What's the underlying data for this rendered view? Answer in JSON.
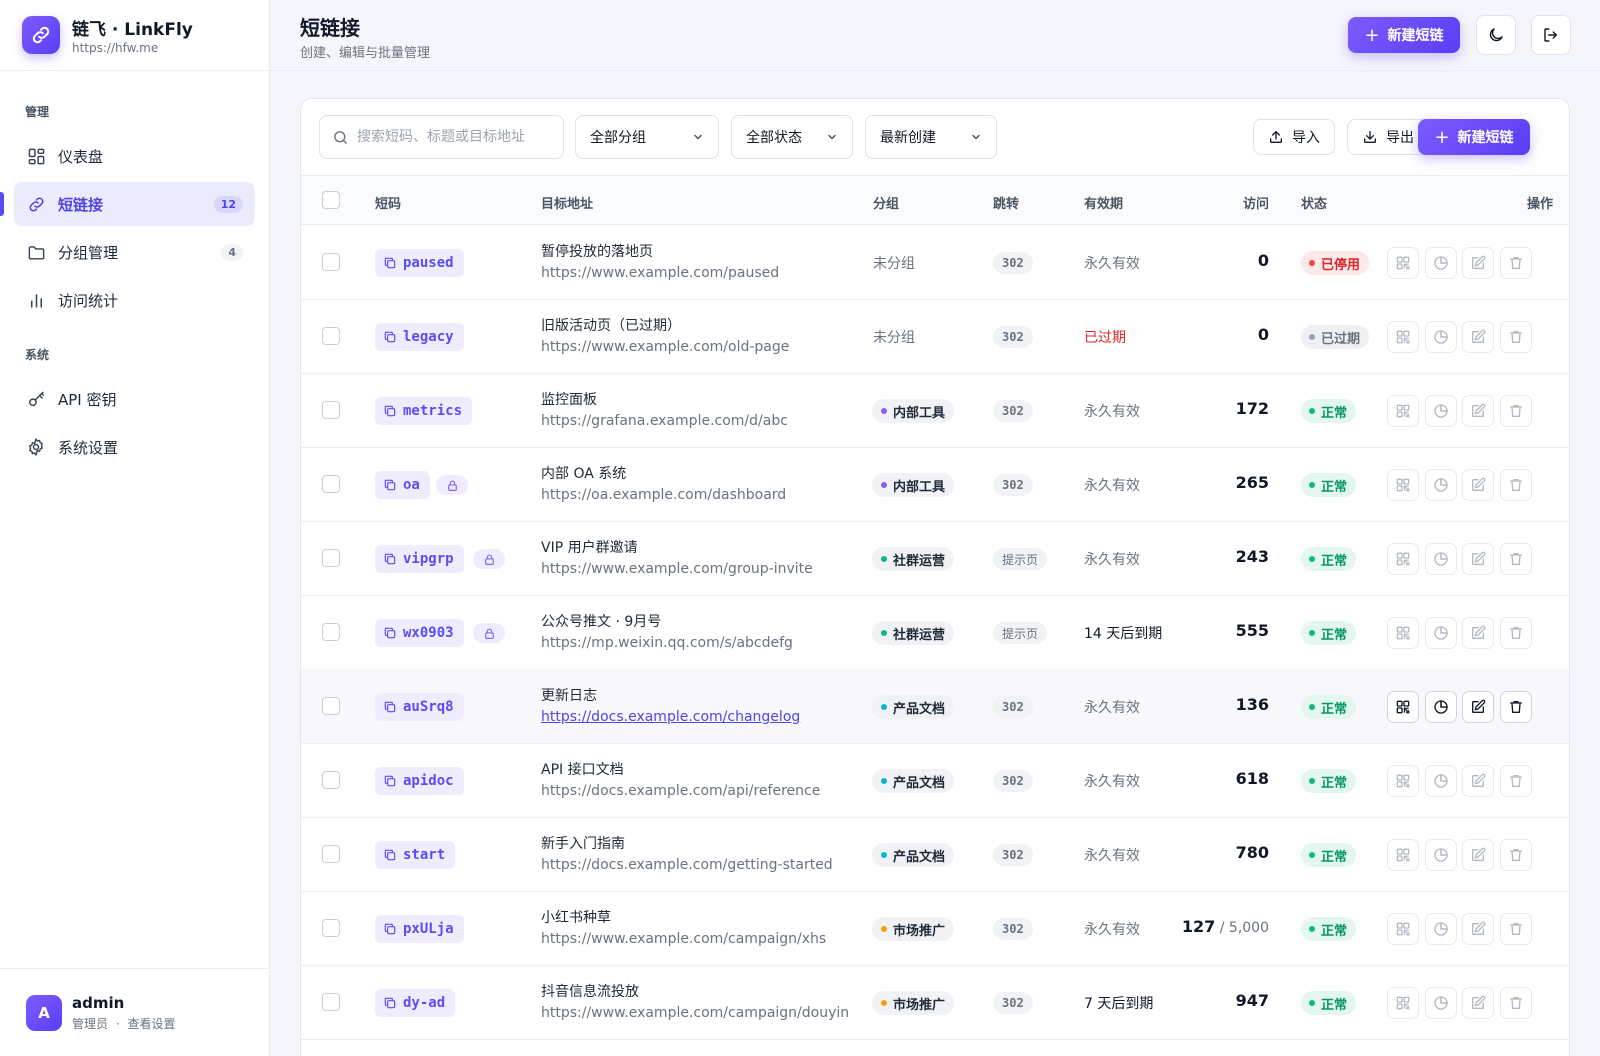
{
  "brand": {
    "title": "链飞 · LinkFly",
    "domain": "https://hfw.me"
  },
  "nav": {
    "section_manage": "管理",
    "section_system": "系统",
    "items": [
      {
        "label": "仪表盘",
        "icon": "dashboard-icon"
      },
      {
        "label": "短链接",
        "icon": "link-icon",
        "badge": "12",
        "active": true
      },
      {
        "label": "分组管理",
        "icon": "folder-icon",
        "badge": "4"
      },
      {
        "label": "访问统计",
        "icon": "bar-chart-icon"
      },
      {
        "label": "API 密钥",
        "icon": "key-icon"
      },
      {
        "label": "系统设置",
        "icon": "gear-icon"
      }
    ]
  },
  "user": {
    "initial": "A",
    "name": "admin",
    "role": "管理员",
    "settings_link": "查看设置",
    "separator": "·"
  },
  "header": {
    "title": "短链接",
    "subtitle": "创建、编辑与批量管理",
    "new_button": "新建短链"
  },
  "toolbar": {
    "search_placeholder": "搜索短码、标题或目标地址",
    "group_filter": "全部分组",
    "status_filter": "全部状态",
    "sort": "最新创建",
    "import": "导入",
    "export": "导出",
    "new_button": "新建短链"
  },
  "table": {
    "columns": {
      "code": "短码",
      "target": "目标地址",
      "group": "分组",
      "redirect": "跳转",
      "expiry": "有效期",
      "visits": "访问",
      "status": "状态",
      "actions": "操作"
    },
    "rows": [
      {
        "code": "paused",
        "locked": false,
        "title": "暂停投放的落地页",
        "url": "https://www.example.com/paused",
        "group": "未分组",
        "group_color": "",
        "redirect": "302",
        "expiry": "永久有效",
        "expiry_style": "normal",
        "visits": "0",
        "limit": "",
        "status": "已停用",
        "status_type": "stopped"
      },
      {
        "code": "legacy",
        "locked": false,
        "title": "旧版活动页（已过期）",
        "url": "https://www.example.com/old-page",
        "group": "未分组",
        "group_color": "",
        "redirect": "302",
        "expiry": "已过期",
        "expiry_style": "red",
        "visits": "0",
        "limit": "",
        "status": "已过期",
        "status_type": "expired"
      },
      {
        "code": "metrics",
        "locked": false,
        "title": "监控面板",
        "url": "https://grafana.example.com/d/abc",
        "group": "内部工具",
        "group_color": "#8b5cf6",
        "redirect": "302",
        "expiry": "永久有效",
        "expiry_style": "normal",
        "visits": "172",
        "limit": "",
        "status": "正常",
        "status_type": "ok"
      },
      {
        "code": "oa",
        "locked": true,
        "title": "内部 OA 系统",
        "url": "https://oa.example.com/dashboard",
        "group": "内部工具",
        "group_color": "#8b5cf6",
        "redirect": "302",
        "expiry": "永久有效",
        "expiry_style": "normal",
        "visits": "265",
        "limit": "",
        "status": "正常",
        "status_type": "ok"
      },
      {
        "code": "vipgrp",
        "locked": true,
        "title": "VIP 用户群邀请",
        "url": "https://www.example.com/group-invite",
        "group": "社群运营",
        "group_color": "#10b981",
        "redirect": "提示页",
        "expiry": "永久有效",
        "expiry_style": "normal",
        "visits": "243",
        "limit": "",
        "status": "正常",
        "status_type": "ok"
      },
      {
        "code": "wx0903",
        "locked": true,
        "title": "公众号推文 · 9月号",
        "url": "https://mp.weixin.qq.com/s/abcdefg",
        "group": "社群运营",
        "group_color": "#10b981",
        "redirect": "提示页",
        "expiry": "14 天后到期",
        "expiry_style": "dark",
        "visits": "555",
        "limit": "",
        "status": "正常",
        "status_type": "ok"
      },
      {
        "code": "auSrq8",
        "locked": false,
        "title": "更新日志",
        "url": "https://docs.example.com/changelog",
        "group": "产品文档",
        "group_color": "#06b6d4",
        "redirect": "302",
        "expiry": "永久有效",
        "expiry_style": "normal",
        "visits": "136",
        "limit": "",
        "status": "正常",
        "status_type": "ok",
        "hover": true
      },
      {
        "code": "apidoc",
        "locked": false,
        "title": "API 接口文档",
        "url": "https://docs.example.com/api/reference",
        "group": "产品文档",
        "group_color": "#06b6d4",
        "redirect": "302",
        "expiry": "永久有效",
        "expiry_style": "normal",
        "visits": "618",
        "limit": "",
        "status": "正常",
        "status_type": "ok"
      },
      {
        "code": "start",
        "locked": false,
        "title": "新手入门指南",
        "url": "https://docs.example.com/getting-started",
        "group": "产品文档",
        "group_color": "#06b6d4",
        "redirect": "302",
        "expiry": "永久有效",
        "expiry_style": "normal",
        "visits": "780",
        "limit": "",
        "status": "正常",
        "status_type": "ok"
      },
      {
        "code": "pxULja",
        "locked": false,
        "title": "小红书种草",
        "url": "https://www.example.com/campaign/xhs",
        "group": "市场推广",
        "group_color": "#f59e0b",
        "redirect": "302",
        "expiry": "永久有效",
        "expiry_style": "normal",
        "visits": "127",
        "limit": " / 5,000",
        "status": "正常",
        "status_type": "ok"
      },
      {
        "code": "dy-ad",
        "locked": false,
        "title": "抖音信息流投放",
        "url": "https://www.example.com/campaign/douyin",
        "group": "市场推广",
        "group_color": "#f59e0b",
        "redirect": "302",
        "expiry": "7 天后到期",
        "expiry_style": "dark",
        "visits": "947",
        "limit": "",
        "status": "正常",
        "status_type": "ok"
      }
    ]
  },
  "colors": {
    "accent": "#5b4cf5",
    "ok": "#059669",
    "danger": "#dc2626"
  }
}
